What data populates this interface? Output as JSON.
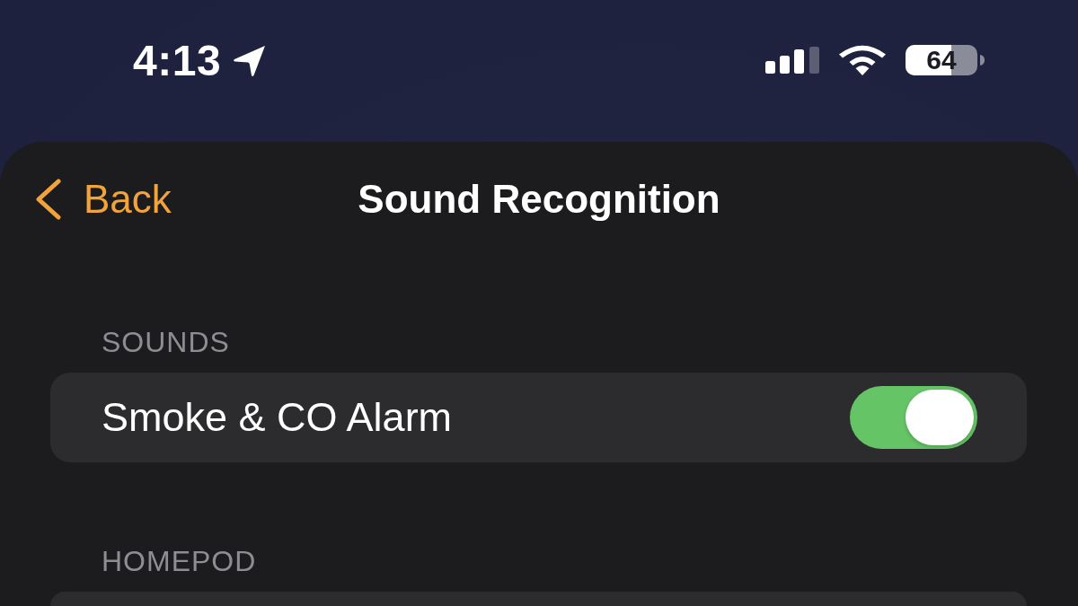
{
  "status_bar": {
    "time": "4:13",
    "battery": "64"
  },
  "nav": {
    "back": "Back",
    "title": "Sound Recognition"
  },
  "sections": [
    {
      "header": "SOUNDS",
      "rows": [
        {
          "label": "Smoke & CO Alarm",
          "on": true
        }
      ]
    },
    {
      "header": "HOMEPOD"
    }
  ]
}
